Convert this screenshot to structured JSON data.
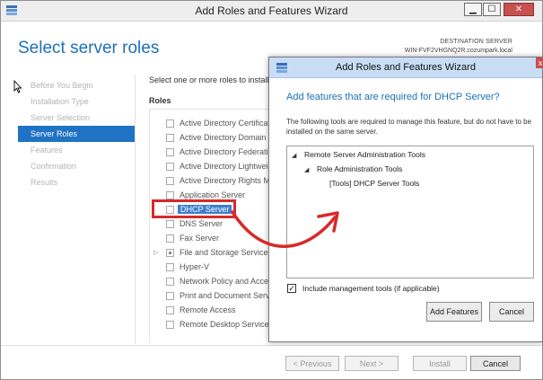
{
  "main_window": {
    "title": "Add Roles and Features Wizard",
    "header": "Select server roles",
    "destination_label": "DESTINATION SERVER",
    "destination_server": "WIN-FVF2VHGNQ2R.cozumpark.local",
    "nav": [
      {
        "label": "Before You Begin",
        "state": "disabled"
      },
      {
        "label": "Installation Type",
        "state": "disabled"
      },
      {
        "label": "Server Selection",
        "state": "disabled"
      },
      {
        "label": "Server Roles",
        "state": "active"
      },
      {
        "label": "Features",
        "state": "disabled"
      },
      {
        "label": "Confirmation",
        "state": "disabled"
      },
      {
        "label": "Results",
        "state": "disabled"
      }
    ],
    "instruction": "Select one or more roles to install",
    "roles_heading": "Roles",
    "roles": [
      {
        "label": "Active Directory Certificat"
      },
      {
        "label": "Active Directory Domain"
      },
      {
        "label": "Active Directory Federatio"
      },
      {
        "label": "Active Directory Lightweig"
      },
      {
        "label": "Active Directory Rights M"
      },
      {
        "label": "Application Server"
      },
      {
        "label": "DHCP Server",
        "selected": true
      },
      {
        "label": "DNS Server"
      },
      {
        "label": "Fax Server"
      },
      {
        "label": "File and Storage Services",
        "expandable": true,
        "partial": true
      },
      {
        "label": "Hyper-V"
      },
      {
        "label": "Network Policy and Acce"
      },
      {
        "label": "Print and Document Serv"
      },
      {
        "label": "Remote Access"
      },
      {
        "label": "Remote Desktop Services"
      }
    ],
    "buttons": {
      "previous": "< Previous",
      "next": "Next >",
      "install": "Install",
      "cancel": "Cancel"
    },
    "window_controls": {
      "minimize": "▁",
      "maximize": "☐",
      "close": "✕"
    }
  },
  "dialog": {
    "title": "Add Roles and Features Wizard",
    "heading": "Add features that are required for DHCP Server?",
    "description": "The following tools are required to manage this feature, but do not have to be installed on the same server.",
    "tree": [
      {
        "label": "Remote Server Administration Tools",
        "level": 0,
        "expanded": true
      },
      {
        "label": "Role Administration Tools",
        "level": 1,
        "expanded": true
      },
      {
        "label": "[Tools] DHCP Server Tools",
        "level": 2
      }
    ],
    "include_label": "Include management tools (if applicable)",
    "include_checked": true,
    "buttons": {
      "add": "Add Features",
      "cancel": "Cancel"
    },
    "close_glyph": "x"
  },
  "colors": {
    "accent": "#1e6fb8",
    "selection": "#1f72c4",
    "annotation_red": "#d72a2a"
  }
}
